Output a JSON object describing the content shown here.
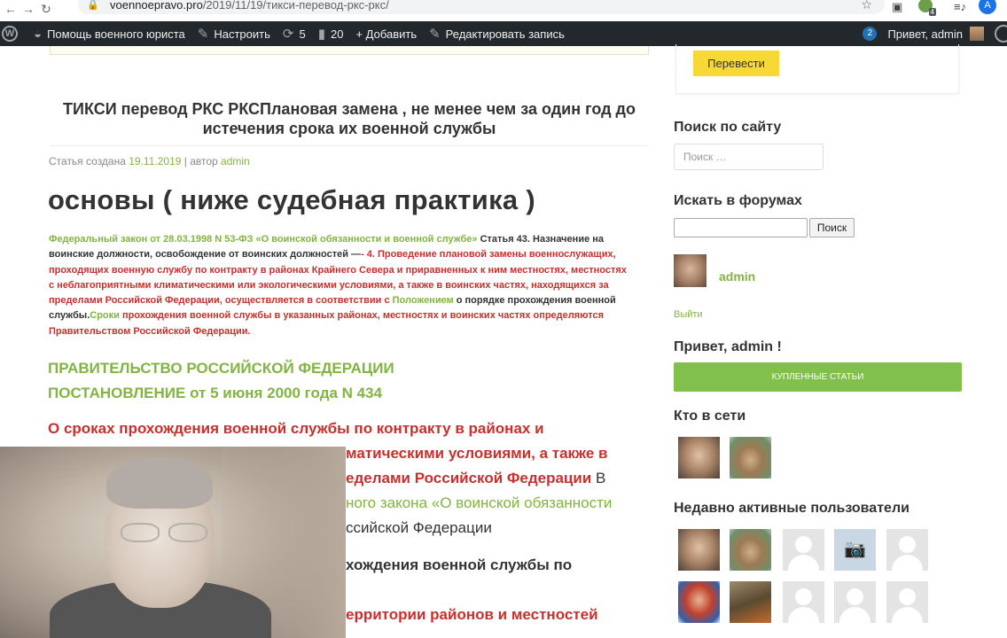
{
  "browser": {
    "url_host": "voennoepravo.pro",
    "url_path": "/2019/11/19/тикси-перевод-ркс-ркс/",
    "profile_initial": "A",
    "ext_badge": "4"
  },
  "adminbar": {
    "site_name": "Помощь военного юриста",
    "customize": "Настроить",
    "updates_count": "5",
    "comments_count": "20",
    "add_new": "+ Добавить",
    "edit_post": "Редактировать запись",
    "notif_count": "2",
    "greeting": "Привет, admin"
  },
  "post": {
    "title": "ТИКСИ перевод РКС РКСПлановая замена , не менее чем за один год до истечения срока их военной службы",
    "meta_prefix": "Статья создана ",
    "meta_date": "19.11.2019",
    "meta_by": " | автор ",
    "meta_author": "admin",
    "heading": "основы ( ниже судебная практика )",
    "law_green": "Федеральный закон от 28.03.1998 N 53-ФЗ «О воинской обязанности и военной службе»",
    "law_dark": "  Статья 43. Назначение на воинские должности, освобождение от воинских должностей —",
    "law_red": "- 4. Проведение плановой замены военнослужащих, проходящих военную службу по контракту в районах Крайнего Севера и приравненных к ним местностях, местностях с неблагоприятными климатическими или экологическими условиями, а также в воинских частях, находящихся за пределами Российской Федерации, осуществляется в соответствии с ",
    "law_green2": "Положением",
    "law_dark2": " о порядке прохождения военной службы.",
    "law_green3": "Сроки",
    "law_red2": " прохождения военной службы в указанных районах, местностях и воинских частях определяются Правительством Российской Федерации.",
    "gov_line1": "ПРАВИТЕЛЬСТВО РОССИЙСКОЙ ФЕДЕРАЦИИ",
    "gov_line2": "ПОСТАНОВЛЕНИЕ от 5 июня 2000 года N 434",
    "red_heading": "О сроках прохождения военной службы по контракту в районах и",
    "frag1": "матическими условиями, а также в",
    "frag2a": "еделами Российской Федерации",
    "frag2b": " В",
    "frag3": "ного закона «О воинской обязанности",
    "frag4": "ссийской Федерации",
    "frag5": "хождения военной службы по",
    "frag6": "ерритории районов и местностей"
  },
  "sidebar": {
    "translate_btn": "Перевести",
    "search_title": "Поиск по сайту",
    "search_placeholder": "Поиск …",
    "forum_title": "Искать в форумах",
    "forum_btn": "Поиск",
    "user_name": "admin",
    "logout": "Выйти",
    "hello": "Привет, admin !",
    "bought_btn": "КУПЛЕННЫЕ СТАТЬИ",
    "online_title": "Кто в сети",
    "recent_title": "Недавно активные пользователи"
  },
  "colors": {
    "accent_green": "#81b441",
    "accent_red": "#c7302c",
    "button_yellow": "#f7d836",
    "adminbar_bg": "#23282d"
  }
}
